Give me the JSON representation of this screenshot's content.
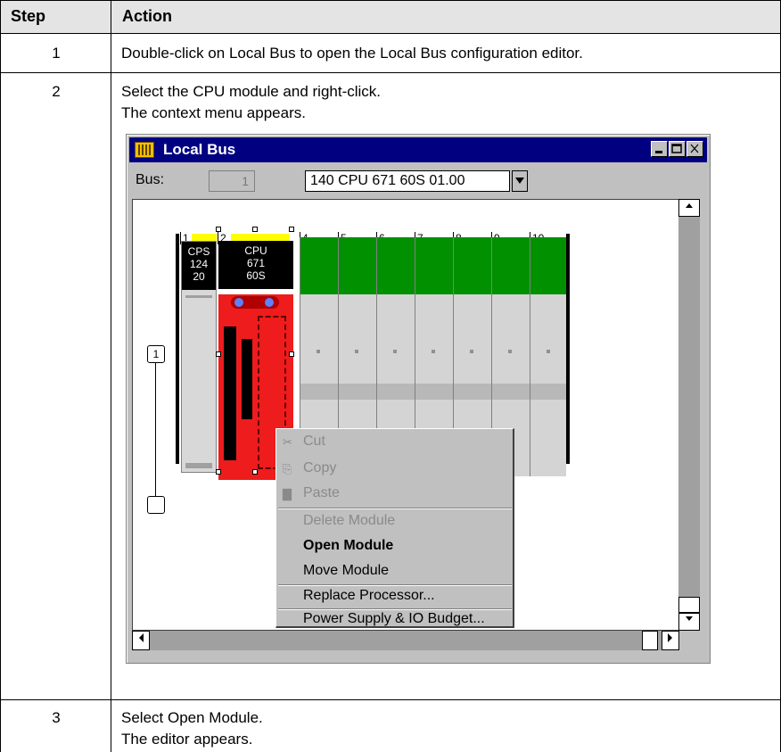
{
  "table": {
    "headers": {
      "step": "Step",
      "action": "Action"
    },
    "rows": [
      {
        "step": "1",
        "lines": [
          "Double-click on Local Bus to open the Local Bus configuration editor."
        ]
      },
      {
        "step": "2",
        "lines": [
          "Select the CPU module and right-click.",
          "The context menu appears."
        ]
      },
      {
        "step": "3",
        "lines": [
          "Select Open Module.",
          "The editor appears."
        ]
      }
    ]
  },
  "window": {
    "title": "Local Bus",
    "bus_label": "Bus:",
    "bus_value": "1",
    "cpu_selected": "140 CPU 671 60S 01.00",
    "icons": {
      "app": "rack-icon",
      "minimize": "minimize-icon",
      "maximize": "maximize-icon",
      "close": "close-icon"
    }
  },
  "rack": {
    "slots": [
      "1",
      "2",
      "4",
      "5",
      "6",
      "7",
      "8",
      "9",
      "10"
    ],
    "cps_label": [
      "CPS",
      "124",
      "20"
    ],
    "cpu_label": [
      "CPU",
      "671",
      "60S"
    ],
    "rack_number": "1"
  },
  "context_menu": {
    "items": [
      {
        "label": "Cut",
        "state": "disabled",
        "icon": "scissors-icon"
      },
      {
        "label": "Copy",
        "state": "disabled",
        "icon": "copy-icon"
      },
      {
        "label": "Paste",
        "state": "disabled",
        "icon": "paste-icon"
      },
      {
        "label": "Delete Module",
        "state": "disabled"
      },
      {
        "label": "Open Module",
        "state": "default"
      },
      {
        "label": "Move Module",
        "state": "enabled"
      },
      {
        "label": "Replace Processor...",
        "state": "enabled"
      },
      {
        "label": "Power Supply & IO Budget...",
        "state": "enabled"
      }
    ]
  },
  "colors": {
    "title_bar": "#000080",
    "cpu_module": "#ee1c1c",
    "io_module": "#009000",
    "slot_marker": "#ffff00"
  }
}
